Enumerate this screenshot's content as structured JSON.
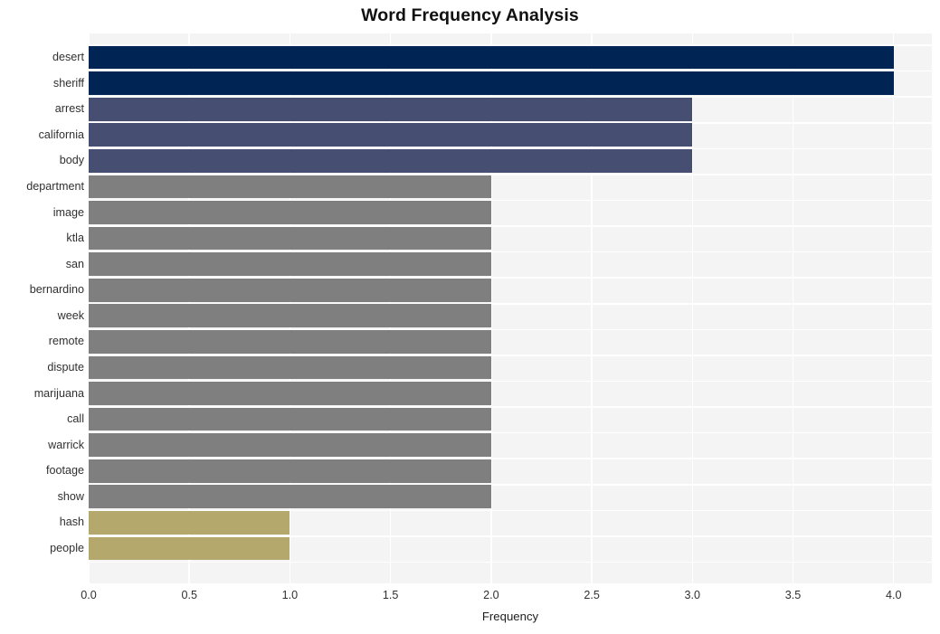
{
  "chart_data": {
    "type": "bar",
    "orientation": "horizontal",
    "title": "Word Frequency Analysis",
    "xlabel": "Frequency",
    "ylabel": "",
    "xlim": [
      0.0,
      4.19
    ],
    "xticks": [
      "0.0",
      "0.5",
      "1.0",
      "1.5",
      "2.0",
      "2.5",
      "3.0",
      "3.5",
      "4.0"
    ],
    "xtick_values": [
      0.0,
      0.5,
      1.0,
      1.5,
      2.0,
      2.5,
      3.0,
      3.5,
      4.0
    ],
    "grid": true,
    "legend": "none",
    "categories": [
      "desert",
      "sheriff",
      "arrest",
      "california",
      "body",
      "department",
      "image",
      "ktla",
      "san",
      "bernardino",
      "week",
      "remote",
      "dispute",
      "marijuana",
      "call",
      "warrick",
      "footage",
      "show",
      "hash",
      "people"
    ],
    "values": [
      4,
      4,
      3,
      3,
      3,
      2,
      2,
      2,
      2,
      2,
      2,
      2,
      2,
      2,
      2,
      2,
      2,
      2,
      1,
      1
    ],
    "bar_colors": [
      "#002454",
      "#002454",
      "#464f72",
      "#464f72",
      "#464f72",
      "#7f7f7f",
      "#7f7f7f",
      "#7f7f7f",
      "#7f7f7f",
      "#7f7f7f",
      "#7f7f7f",
      "#7f7f7f",
      "#7f7f7f",
      "#7f7f7f",
      "#7f7f7f",
      "#7f7f7f",
      "#7f7f7f",
      "#7f7f7f",
      "#b5a86c",
      "#b5a86c"
    ],
    "palette": {
      "value_4": "#002454",
      "value_3": "#464f72",
      "value_2": "#7f7f7f",
      "value_1": "#b5a86c",
      "plot_background": "#f4f4f5",
      "gridline": "#ffffff",
      "figure_background": "#ffffff",
      "text": "#303030"
    }
  }
}
